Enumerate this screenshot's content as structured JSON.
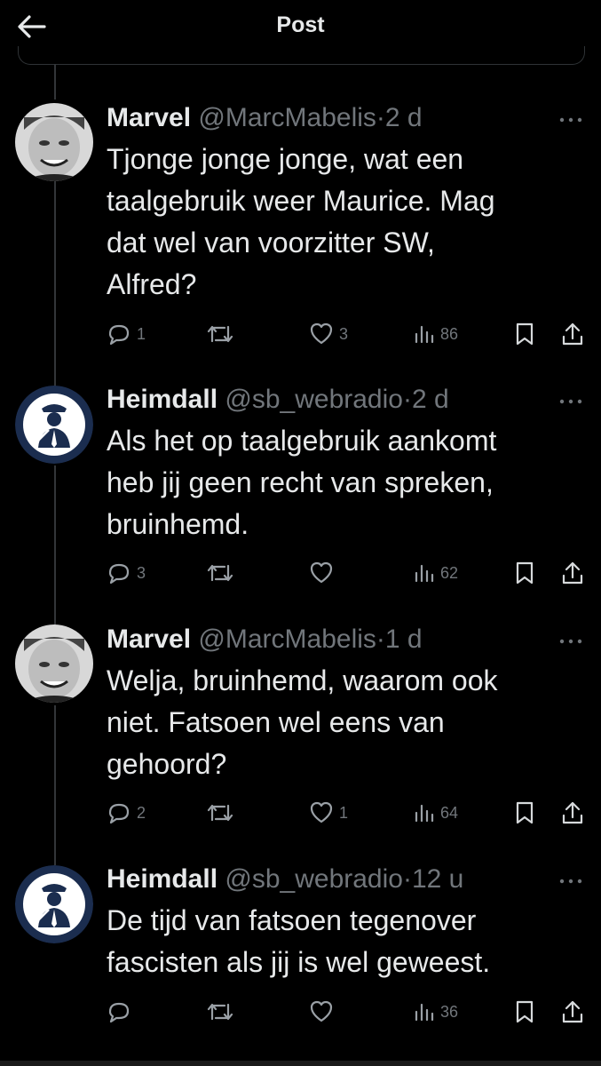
{
  "header": {
    "title": "Post"
  },
  "tweets": [
    {
      "name": "Marvel",
      "handle": "@MarcMabelis",
      "sep": "·",
      "time": "2 d",
      "lines": [
        "Tjonge jonge jonge, wat een",
        "taalgebruik weer Maurice. Mag",
        "dat wel van voorzitter SW,",
        "Alfred?"
      ],
      "replies": "1",
      "reposts": "",
      "likes": "3",
      "views": "86",
      "avatar": "man-photo"
    },
    {
      "name": "Heimdall",
      "handle": "@sb_webradio",
      "sep": "·",
      "time": "2 d",
      "lines": [
        "Als het op taalgebruik aankomt",
        "heb jij geen recht van spreken,",
        "bruinhemd."
      ],
      "replies": "3",
      "reposts": "",
      "likes": "",
      "views": "62",
      "avatar": "figure-logo"
    },
    {
      "name": "Marvel",
      "handle": "@MarcMabelis",
      "sep": "·",
      "time": "1 d",
      "lines": [
        "Welja, bruinhemd, waarom ook",
        "niet. Fatsoen wel eens van",
        "gehoord?"
      ],
      "replies": "2",
      "reposts": "",
      "likes": "1",
      "views": "64",
      "avatar": "man-photo"
    },
    {
      "name": "Heimdall",
      "handle": "@sb_webradio",
      "sep": "·",
      "time": "12 u",
      "lines": [
        "De tijd van fatsoen tegenover",
        "fascisten als jij is wel geweest."
      ],
      "replies": "",
      "reposts": "",
      "likes": "",
      "views": "36",
      "avatar": "figure-logo"
    }
  ],
  "icons": {
    "back": "arrow-left-icon",
    "more": "more-dots-icon",
    "reply": "reply-icon",
    "repost": "repost-icon",
    "like": "heart-icon",
    "views": "views-icon",
    "bookmark": "bookmark-icon",
    "share": "share-icon"
  },
  "colors": {
    "background": "#000000",
    "text": "#e7e9ea",
    "muted": "#71767b",
    "avatar_bg": "#1b2d4f"
  }
}
